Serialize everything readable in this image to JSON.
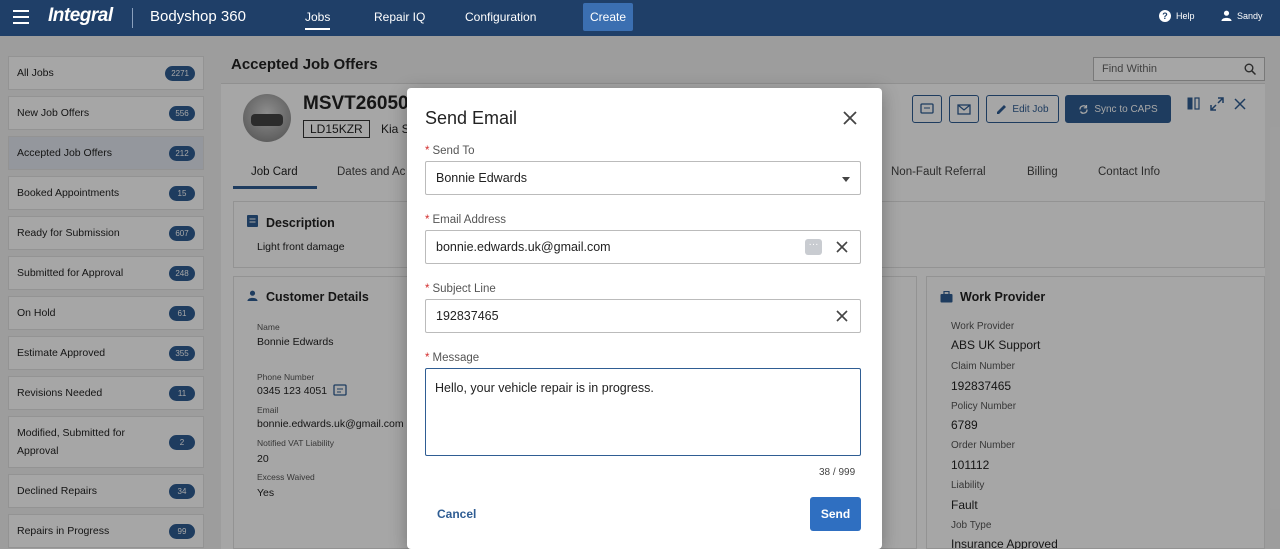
{
  "topbar": {
    "logo": "Integral",
    "app_name": "Bodyshop 360",
    "nav": [
      "Jobs",
      "Repair IQ",
      "Configuration"
    ],
    "create_label": "Create",
    "help_label": "Help",
    "user_label": "Sandy"
  },
  "sidebar": {
    "items": [
      {
        "label": "All Jobs",
        "count": "2271"
      },
      {
        "label": "New Job Offers",
        "count": "556"
      },
      {
        "label": "Accepted Job Offers",
        "count": "212"
      },
      {
        "label": "Booked Appointments",
        "count": "15"
      },
      {
        "label": "Ready for Submission",
        "count": "607"
      },
      {
        "label": "Submitted for Approval",
        "count": "248"
      },
      {
        "label": "On Hold",
        "count": "61"
      },
      {
        "label": "Estimate Approved",
        "count": "355"
      },
      {
        "label": "Revisions Needed",
        "count": "11"
      },
      {
        "label": "Modified, Submitted for Approval",
        "count": "2"
      },
      {
        "label": "Declined Repairs",
        "count": "34"
      },
      {
        "label": "Repairs in Progress",
        "count": "99"
      }
    ]
  },
  "main": {
    "title": "Accepted Job Offers",
    "find_placeholder": "Find Within",
    "job_number": "MSVT26050",
    "plate": "LD15KZR",
    "vehicle_make": "Kia S",
    "edit_job_label": "Edit Job",
    "sync_label": "Sync to CAPS",
    "tabs": [
      "Job Card",
      "Dates and Ac",
      "Non-Fault Referral",
      "Billing",
      "Contact Info"
    ],
    "description": {
      "title": "Description",
      "text": "Light front damage"
    },
    "customer": {
      "title": "Customer Details",
      "name_label": "Name",
      "name": "Bonnie Edwards",
      "phone_label": "Phone Number",
      "phone": "0345 123 4051",
      "email_label": "Email",
      "email": "bonnie.edwards.uk@gmail.com",
      "vat_label": "Notified VAT Liability",
      "vat": "20",
      "excess_label": "Excess Waived",
      "excess": "Yes"
    },
    "work_provider": {
      "title": "Work Provider",
      "wp_label": "Work Provider",
      "wp": "ABS UK Support",
      "claim_label": "Claim Number",
      "claim": "192837465",
      "policy_label": "Policy Number",
      "policy": "6789",
      "order_label": "Order Number",
      "order": "101112",
      "liability_label": "Liability",
      "liability": "Fault",
      "jobtype_label": "Job Type",
      "jobtype": "Insurance Approved"
    }
  },
  "modal": {
    "title": "Send Email",
    "send_to_label": "Send To",
    "send_to_value": "Bonnie Edwards",
    "email_label": "Email Address",
    "email_value": "bonnie.edwards.uk@gmail.com",
    "subject_label": "Subject Line",
    "subject_value": "192837465",
    "message_label": "Message",
    "message_value": "Hello, your vehicle repair is in progress.",
    "char_count": "38 / 999",
    "cancel_label": "Cancel",
    "send_label": "Send",
    "required_mark": "*"
  },
  "colors": {
    "primary": "#2f5d93",
    "topbar": "#1f3f68",
    "required": "#d32f2f"
  }
}
